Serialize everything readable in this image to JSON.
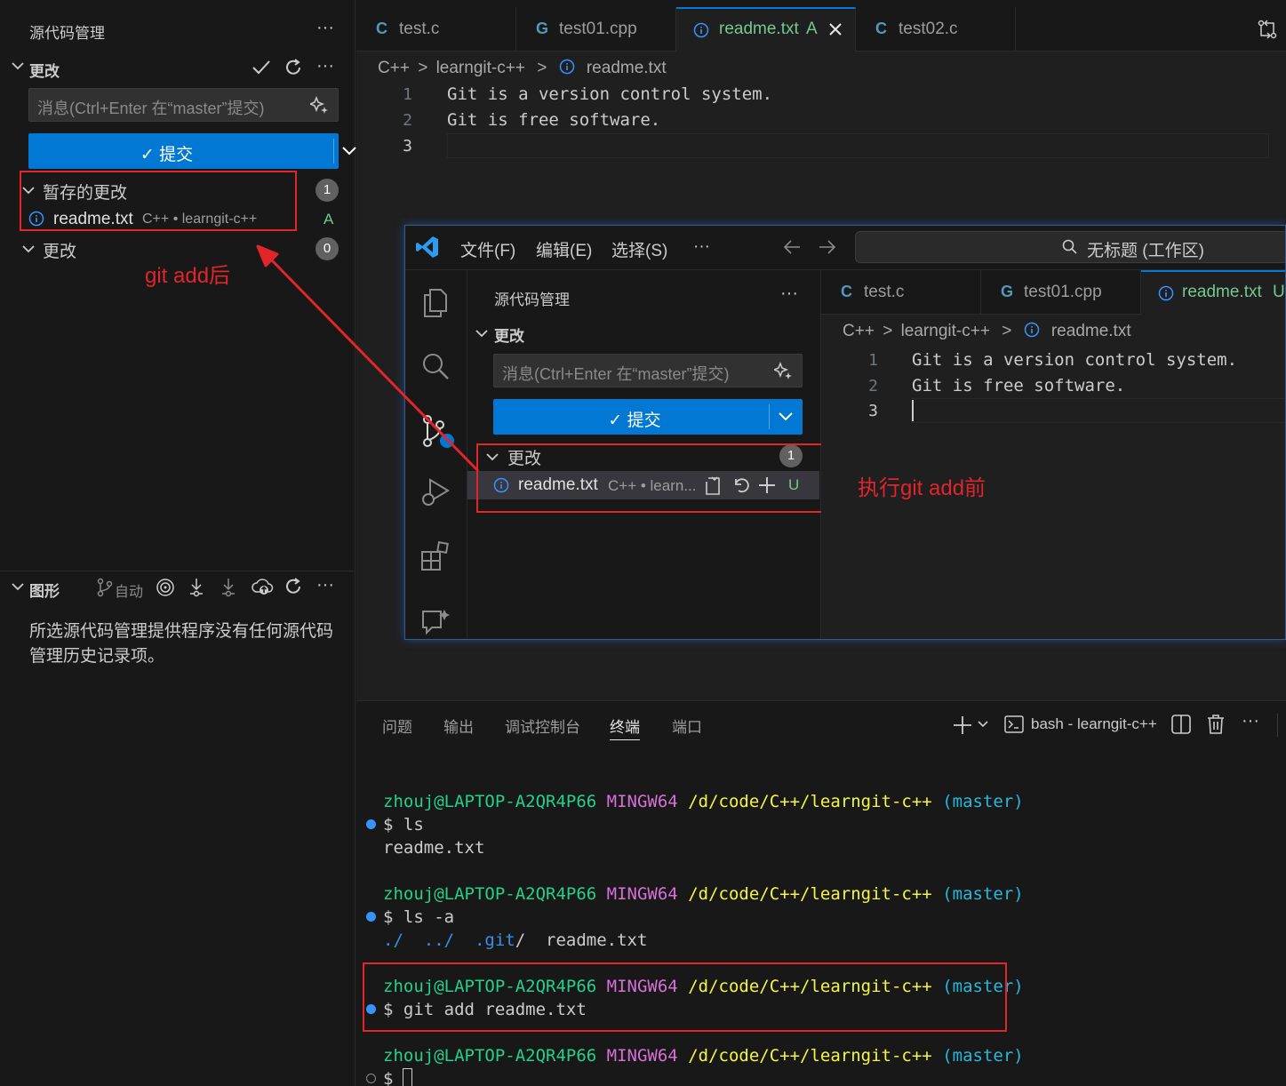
{
  "sidebar": {
    "title": "源代码管理",
    "changes_section": "更改",
    "message_placeholder": "消息(Ctrl+Enter 在“master”提交)",
    "commit_label": "提交",
    "staged_title": "暂存的更改",
    "staged_count": "1",
    "staged_file": {
      "name": "readme.txt",
      "desc": "C++ • learngit-c++",
      "status": "A"
    },
    "changes_title": "更改",
    "changes_count": "0",
    "graph_title": "图形",
    "graph_auto": "自动",
    "graph_empty": "所选源代码管理提供程序没有任何源代码管理历史记录项。"
  },
  "annotations": {
    "after": "git add后",
    "before": "执行git add前"
  },
  "tabs": [
    {
      "icon": "C",
      "name": "test.c"
    },
    {
      "icon": "G",
      "name": "test01.cpp"
    },
    {
      "icon": "i",
      "name": "readme.txt",
      "status": "A"
    },
    {
      "icon": "C",
      "name": "test02.c"
    }
  ],
  "breadcrumb": {
    "lang": "C++",
    "folder": "learngit-c++",
    "file": "readme.txt"
  },
  "editor_lines": [
    {
      "n": "1",
      "text": "Git is a version control system."
    },
    {
      "n": "2",
      "text": "Git is free software."
    },
    {
      "n": "3",
      "text": ""
    }
  ],
  "inset": {
    "menus": [
      "文件(F)",
      "编辑(E)",
      "选择(S)",
      "···"
    ],
    "search": "无标题 (工作区)",
    "side_title": "源代码管理",
    "changes_section": "更改",
    "message_placeholder": "消息(Ctrl+Enter 在“master”提交)",
    "commit_label": "提交",
    "changes_title": "更改",
    "changes_count": "1",
    "file": {
      "name": "readme.txt",
      "desc": "C++ • learn...",
      "status": "U"
    },
    "tabs": [
      {
        "icon": "C",
        "name": "test.c"
      },
      {
        "icon": "G",
        "name": "test01.cpp"
      },
      {
        "icon": "i",
        "name": "readme.txt",
        "status": "U"
      }
    ],
    "breadcrumb": {
      "lang": "C++",
      "folder": "learngit-c++",
      "file": "readme.txt"
    },
    "lines": [
      {
        "n": "1",
        "text": "Git is a version control system."
      },
      {
        "n": "2",
        "text": "Git is free software."
      },
      {
        "n": "3",
        "text": ""
      }
    ]
  },
  "panel": {
    "tabs": [
      "问题",
      "输出",
      "调试控制台",
      "终端",
      "端口"
    ],
    "active_tab": "终端",
    "terminal_name": "bash - learngit-c++"
  },
  "terminal": {
    "user": "zhouj@LAPTOP-A2QR4P66",
    "env": "MINGW64",
    "path": "/d/code/C++/learngit-c++",
    "branch": "(master)",
    "cmd1": "$ ls",
    "out1": "readme.txt",
    "cmd2": "$ ls -a",
    "out2_a": "./  ../  ",
    "out2_git": ".git",
    "out2_b": "/  readme.txt",
    "cmd3": "$ git add readme.txt",
    "cmd4": "$ "
  },
  "colors": {
    "accent": "#0078d4",
    "annotation": "#e0252b",
    "added": "#73c991"
  }
}
